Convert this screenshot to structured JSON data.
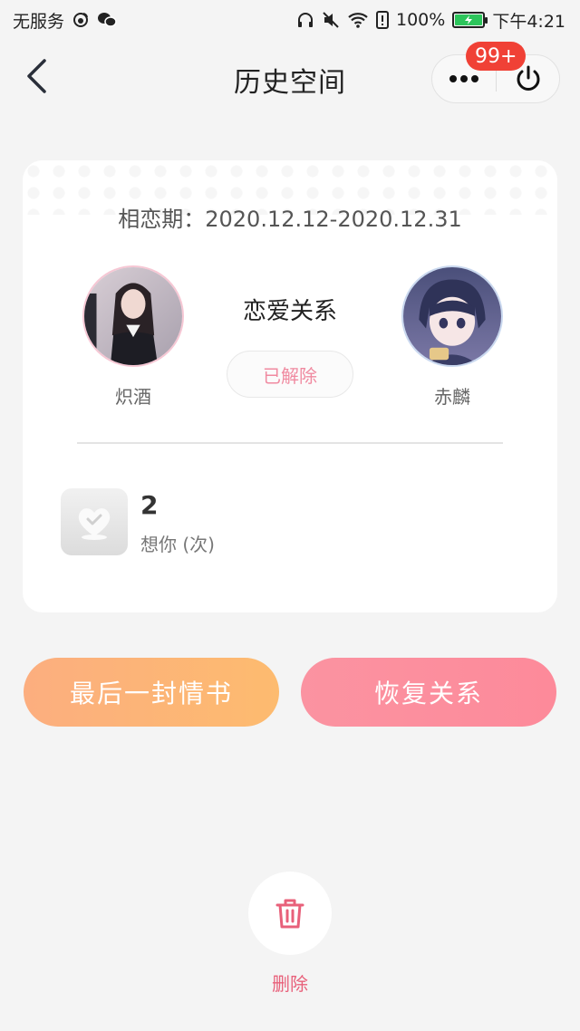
{
  "status_bar": {
    "carrier": "无服务",
    "battery_percent": "100%",
    "time": "下午4:21",
    "battery_color": "#2cc55b"
  },
  "nav": {
    "title": "历史空间",
    "badge": "99+",
    "badge_color": "#f04136"
  },
  "card": {
    "period": "相恋期：2020.12.12-2020.12.31",
    "left_user": {
      "name": "炽酒"
    },
    "right_user": {
      "name": "赤麟"
    },
    "relation_label": "恋爱关系",
    "relation_status": "已解除",
    "miss": {
      "count": "2",
      "label": "想你 (次)"
    }
  },
  "actions": {
    "last_letter": "最后一封情书",
    "restore": "恢复关系",
    "delete": "删除"
  },
  "icons": [
    "back-arrow-icon",
    "more-icon",
    "power-icon",
    "heart-icon",
    "trash-icon",
    "headphones-icon",
    "mute-icon",
    "wifi-icon",
    "battery-icon",
    "wechat-icon",
    "weibo-icon"
  ]
}
